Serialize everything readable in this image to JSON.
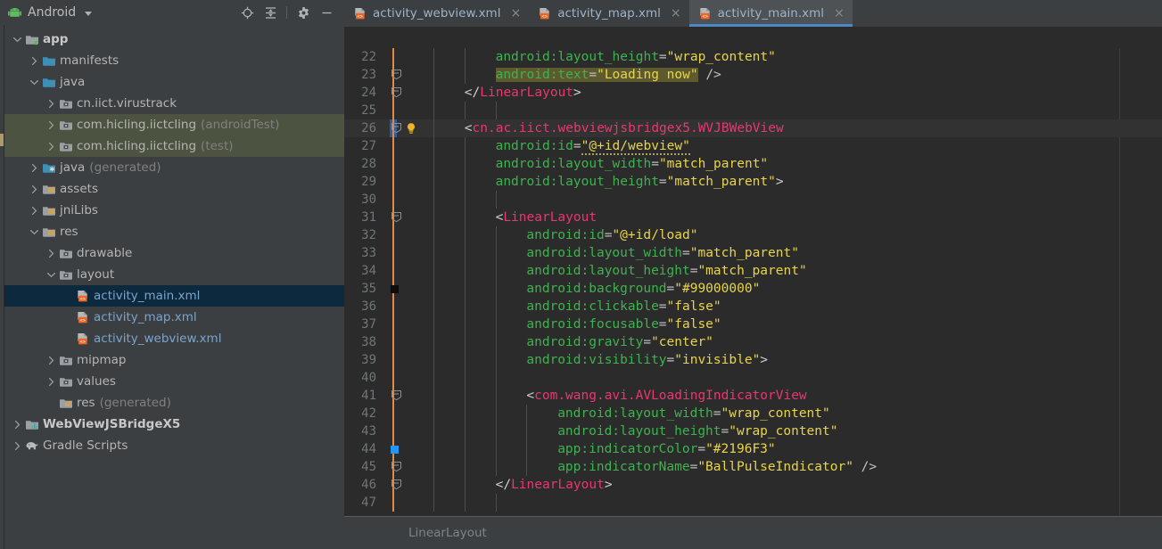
{
  "sidebar": {
    "title": "Android",
    "title_icon": "android-robot-icon",
    "dropdown_icon": "chevron-down-icon",
    "toolbar": [
      {
        "name": "locate-icon",
        "label": "Select Opened File"
      },
      {
        "name": "collapse-all-icon",
        "label": "Collapse All"
      },
      {
        "name": "gear-icon",
        "label": "Settings"
      },
      {
        "name": "minimize-icon",
        "label": "Hide"
      }
    ],
    "items": [
      {
        "label": "app",
        "sub": "",
        "depth": 0,
        "arrow": "expanded",
        "icon": "module-folder-icon",
        "bold": true,
        "state": "normal"
      },
      {
        "label": "manifests",
        "sub": "",
        "depth": 1,
        "arrow": "collapsed",
        "icon": "folder-icon",
        "bold": false,
        "state": "normal"
      },
      {
        "label": "java",
        "sub": "",
        "depth": 1,
        "arrow": "expanded",
        "icon": "folder-icon",
        "bold": false,
        "state": "normal"
      },
      {
        "label": "cn.iict.virustrack",
        "sub": "",
        "depth": 2,
        "arrow": "collapsed",
        "icon": "package-icon",
        "bold": false,
        "state": "normal"
      },
      {
        "label": "com.hicling.iictcling",
        "sub": "(androidTest)",
        "depth": 2,
        "arrow": "collapsed",
        "icon": "package-icon",
        "bold": false,
        "state": "green"
      },
      {
        "label": "com.hicling.iictcling",
        "sub": "(test)",
        "depth": 2,
        "arrow": "collapsed",
        "icon": "package-icon",
        "bold": false,
        "state": "green"
      },
      {
        "label": "java",
        "sub": "(generated)",
        "depth": 1,
        "arrow": "collapsed",
        "icon": "generated-folder-icon",
        "bold": false,
        "state": "normal"
      },
      {
        "label": "assets",
        "sub": "",
        "depth": 1,
        "arrow": "collapsed",
        "icon": "res-folder-icon",
        "bold": false,
        "state": "normal"
      },
      {
        "label": "jniLibs",
        "sub": "",
        "depth": 1,
        "arrow": "collapsed",
        "icon": "res-folder-icon",
        "bold": false,
        "state": "normal"
      },
      {
        "label": "res",
        "sub": "",
        "depth": 1,
        "arrow": "expanded",
        "icon": "res-folder-icon",
        "bold": false,
        "state": "normal"
      },
      {
        "label": "drawable",
        "sub": "",
        "depth": 2,
        "arrow": "collapsed",
        "icon": "package-icon",
        "bold": false,
        "state": "normal"
      },
      {
        "label": "layout",
        "sub": "",
        "depth": 2,
        "arrow": "expanded",
        "icon": "package-icon",
        "bold": false,
        "state": "normal"
      },
      {
        "label": "activity_main.xml",
        "sub": "",
        "depth": 3,
        "arrow": "none",
        "icon": "layout-xml-icon",
        "bold": false,
        "state": "selected"
      },
      {
        "label": "activity_map.xml",
        "sub": "",
        "depth": 3,
        "arrow": "none",
        "icon": "layout-xml-icon",
        "bold": false,
        "state": "normal"
      },
      {
        "label": "activity_webview.xml",
        "sub": "",
        "depth": 3,
        "arrow": "none",
        "icon": "layout-xml-icon",
        "bold": false,
        "state": "normal"
      },
      {
        "label": "mipmap",
        "sub": "",
        "depth": 2,
        "arrow": "collapsed",
        "icon": "package-icon",
        "bold": false,
        "state": "normal"
      },
      {
        "label": "values",
        "sub": "",
        "depth": 2,
        "arrow": "collapsed",
        "icon": "package-icon",
        "bold": false,
        "state": "normal"
      },
      {
        "label": "res",
        "sub": "(generated)",
        "depth": 2,
        "arrow": "none",
        "icon": "res-folder-icon",
        "bold": false,
        "state": "normal"
      },
      {
        "label": "WebViewJSBridgeX5",
        "sub": "",
        "depth": 0,
        "arrow": "collapsed",
        "icon": "library-module-icon",
        "bold": true,
        "state": "normal"
      },
      {
        "label": "Gradle Scripts",
        "sub": "",
        "depth": 0,
        "arrow": "collapsed",
        "icon": "gradle-elephant-icon",
        "bold": false,
        "state": "normal"
      }
    ]
  },
  "editor": {
    "tabs": [
      {
        "label": "activity_webview.xml",
        "icon": "layout-xml-icon",
        "active": false,
        "close_icon": "close-icon"
      },
      {
        "label": "activity_map.xml",
        "icon": "layout-xml-icon",
        "active": false,
        "close_icon": "close-icon"
      },
      {
        "label": "activity_main.xml",
        "icon": "layout-xml-icon",
        "active": true,
        "close_icon": "close-icon"
      }
    ],
    "first_line_number": 22,
    "current_line": 26,
    "breadcrumb": "LinearLayout",
    "colors": {
      "tag": "#e8386e",
      "attribute": "#3fb24f",
      "value": "#e8d44c",
      "background": "#2b2b2b",
      "accent": "#4a88c7",
      "search_highlight": "#5c5a2e",
      "swatch_line_35": "#0d0d0d",
      "swatch_line_44": "#2196F3"
    },
    "lines": [
      {
        "n": 22,
        "indent": 8,
        "gutter": "",
        "tokens": [
          {
            "t": "attr",
            "s": "android:layout_height"
          },
          {
            "t": "eq",
            "s": "="
          },
          {
            "t": "val",
            "s": "\"wrap_content\""
          }
        ]
      },
      {
        "n": 23,
        "indent": 8,
        "gutter": "fold",
        "tokens": [
          {
            "t": "hl-attr",
            "s": "android:text"
          },
          {
            "t": "hl-eq",
            "s": "="
          },
          {
            "t": "hl-val",
            "s": "\"Loading now\""
          },
          {
            "t": "plain",
            "s": " "
          },
          {
            "t": "slash",
            "s": "/>"
          }
        ]
      },
      {
        "n": 24,
        "indent": 4,
        "gutter": "fold",
        "tokens": [
          {
            "t": "punct",
            "s": "</"
          },
          {
            "t": "tag",
            "s": "LinearLayout"
          },
          {
            "t": "punct",
            "s": ">"
          }
        ]
      },
      {
        "n": 25,
        "indent": 0,
        "gutter": "",
        "tokens": []
      },
      {
        "n": 26,
        "indent": 4,
        "gutter": "fold-bulb-sel",
        "tokens": [
          {
            "t": "punct",
            "s": "<"
          },
          {
            "t": "tag",
            "s": "cn.ac.iict.webviewjsbridgex5.WVJBWebView"
          }
        ]
      },
      {
        "n": 27,
        "indent": 8,
        "gutter": "",
        "tokens": [
          {
            "t": "attr",
            "s": "android:id"
          },
          {
            "t": "eq",
            "s": "="
          },
          {
            "t": "val-squig",
            "s": "\"@+id/webview\""
          }
        ]
      },
      {
        "n": 28,
        "indent": 8,
        "gutter": "",
        "tokens": [
          {
            "t": "attr",
            "s": "android:layout_width"
          },
          {
            "t": "eq",
            "s": "="
          },
          {
            "t": "val",
            "s": "\"match_parent\""
          }
        ]
      },
      {
        "n": 29,
        "indent": 8,
        "gutter": "",
        "tokens": [
          {
            "t": "attr",
            "s": "android:layout_height"
          },
          {
            "t": "eq",
            "s": "="
          },
          {
            "t": "val",
            "s": "\"match_parent\""
          },
          {
            "t": "punct",
            "s": ">"
          }
        ]
      },
      {
        "n": 30,
        "indent": 0,
        "gutter": "",
        "tokens": []
      },
      {
        "n": 31,
        "indent": 8,
        "gutter": "fold",
        "tokens": [
          {
            "t": "punct",
            "s": "<"
          },
          {
            "t": "tag",
            "s": "LinearLayout"
          }
        ]
      },
      {
        "n": 32,
        "indent": 12,
        "gutter": "",
        "tokens": [
          {
            "t": "attr",
            "s": "android:id"
          },
          {
            "t": "eq",
            "s": "="
          },
          {
            "t": "val",
            "s": "\"@+id/load\""
          }
        ]
      },
      {
        "n": 33,
        "indent": 12,
        "gutter": "",
        "tokens": [
          {
            "t": "attr",
            "s": "android:layout_width"
          },
          {
            "t": "eq",
            "s": "="
          },
          {
            "t": "val",
            "s": "\"match_parent\""
          }
        ]
      },
      {
        "n": 34,
        "indent": 12,
        "gutter": "",
        "tokens": [
          {
            "t": "attr",
            "s": "android:layout_height"
          },
          {
            "t": "eq",
            "s": "="
          },
          {
            "t": "val",
            "s": "\"match_parent\""
          }
        ]
      },
      {
        "n": 35,
        "indent": 12,
        "gutter": "swatch-dark",
        "tokens": [
          {
            "t": "attr",
            "s": "android:background"
          },
          {
            "t": "eq",
            "s": "="
          },
          {
            "t": "val",
            "s": "\"#99000000\""
          }
        ]
      },
      {
        "n": 36,
        "indent": 12,
        "gutter": "",
        "tokens": [
          {
            "t": "attr",
            "s": "android:clickable"
          },
          {
            "t": "eq",
            "s": "="
          },
          {
            "t": "val",
            "s": "\"false\""
          }
        ]
      },
      {
        "n": 37,
        "indent": 12,
        "gutter": "",
        "tokens": [
          {
            "t": "attr",
            "s": "android:focusable"
          },
          {
            "t": "eq",
            "s": "="
          },
          {
            "t": "val",
            "s": "\"false\""
          }
        ]
      },
      {
        "n": 38,
        "indent": 12,
        "gutter": "",
        "tokens": [
          {
            "t": "attr",
            "s": "android:gravity"
          },
          {
            "t": "eq",
            "s": "="
          },
          {
            "t": "val",
            "s": "\"center\""
          }
        ]
      },
      {
        "n": 39,
        "indent": 12,
        "gutter": "",
        "tokens": [
          {
            "t": "attr",
            "s": "android:visibility"
          },
          {
            "t": "eq",
            "s": "="
          },
          {
            "t": "val",
            "s": "\"invisible\""
          },
          {
            "t": "punct",
            "s": ">"
          }
        ]
      },
      {
        "n": 40,
        "indent": 0,
        "gutter": "",
        "tokens": []
      },
      {
        "n": 41,
        "indent": 12,
        "gutter": "fold",
        "tokens": [
          {
            "t": "punct",
            "s": "<"
          },
          {
            "t": "tag",
            "s": "com.wang.avi.AVLoadingIndicatorView"
          }
        ]
      },
      {
        "n": 42,
        "indent": 16,
        "gutter": "",
        "tokens": [
          {
            "t": "attr",
            "s": "android:layout_width"
          },
          {
            "t": "eq",
            "s": "="
          },
          {
            "t": "val",
            "s": "\"wrap_content\""
          }
        ]
      },
      {
        "n": 43,
        "indent": 16,
        "gutter": "",
        "tokens": [
          {
            "t": "attr",
            "s": "android:layout_height"
          },
          {
            "t": "eq",
            "s": "="
          },
          {
            "t": "val",
            "s": "\"wrap_content\""
          }
        ]
      },
      {
        "n": 44,
        "indent": 16,
        "gutter": "swatch-blue",
        "tokens": [
          {
            "t": "attr",
            "s": "app:indicatorColor"
          },
          {
            "t": "eq",
            "s": "="
          },
          {
            "t": "val",
            "s": "\"#2196F3\""
          }
        ]
      },
      {
        "n": 45,
        "indent": 16,
        "gutter": "fold",
        "tokens": [
          {
            "t": "attr",
            "s": "app:indicatorName"
          },
          {
            "t": "eq",
            "s": "="
          },
          {
            "t": "val",
            "s": "\"BallPulseIndicator\""
          },
          {
            "t": "plain",
            "s": " "
          },
          {
            "t": "slash",
            "s": "/>"
          }
        ]
      },
      {
        "n": 46,
        "indent": 8,
        "gutter": "fold",
        "tokens": [
          {
            "t": "punct",
            "s": "</"
          },
          {
            "t": "tag",
            "s": "LinearLayout"
          },
          {
            "t": "punct",
            "s": ">"
          }
        ]
      },
      {
        "n": 47,
        "indent": 0,
        "gutter": "",
        "tokens": []
      }
    ]
  }
}
